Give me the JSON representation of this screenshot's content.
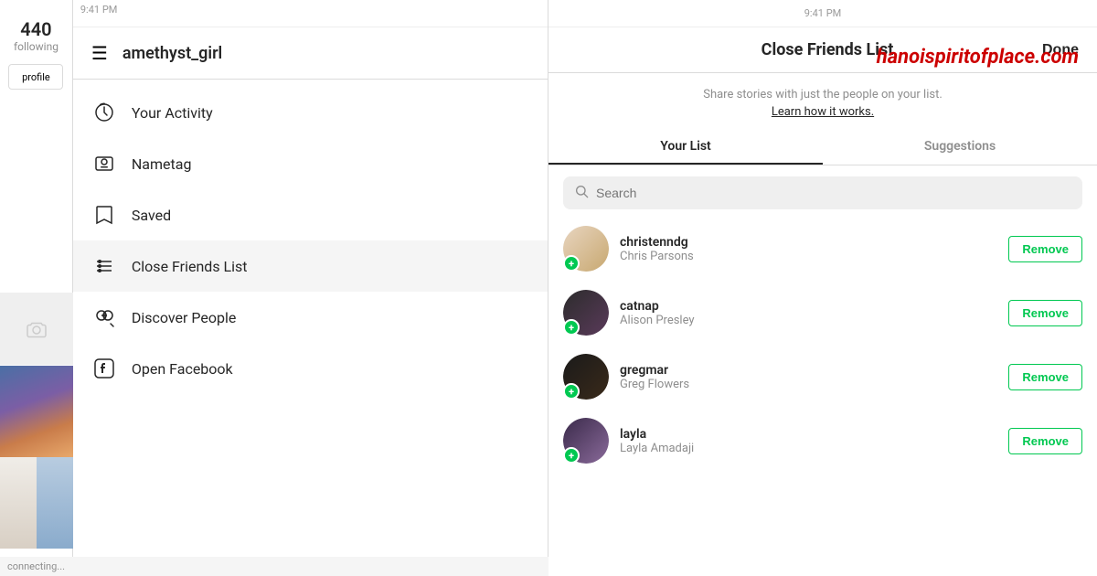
{
  "left": {
    "top_bar": "9:41 PM",
    "following_number": "440",
    "following_label": "following",
    "profile_button": "profile",
    "username": "amethyst_girl",
    "menu_items": [
      {
        "id": "activity",
        "label": "Your Activity",
        "icon": "activity"
      },
      {
        "id": "nametag",
        "label": "Nametag",
        "icon": "nametag"
      },
      {
        "id": "saved",
        "label": "Saved",
        "icon": "saved"
      },
      {
        "id": "close-friends",
        "label": "Close Friends List",
        "icon": "close-friends",
        "active": true
      },
      {
        "id": "discover",
        "label": "Discover People",
        "icon": "discover"
      },
      {
        "id": "facebook",
        "label": "Open Facebook",
        "icon": "facebook"
      }
    ]
  },
  "right": {
    "top_bar": "9:41 PM",
    "title": "Close Friends List",
    "done_label": "Done",
    "watermark": "hanoispiritofplace.com",
    "subtitle": "Share stories with just the people on your list.",
    "learn_link": "Learn how it works.",
    "tabs": [
      {
        "id": "your-list",
        "label": "Your List",
        "active": true
      },
      {
        "id": "suggestions",
        "label": "Suggestions",
        "active": false
      }
    ],
    "search_placeholder": "Search",
    "friends": [
      {
        "username": "christenndg",
        "name": "Chris Parsons",
        "avatar": "1",
        "remove_label": "Remove"
      },
      {
        "username": "catnap",
        "name": "Alison Presley",
        "avatar": "2",
        "remove_label": "Remove"
      },
      {
        "username": "gregmar",
        "name": "Greg Flowers",
        "avatar": "3",
        "remove_label": "Remove"
      },
      {
        "username": "layla",
        "name": "Layla Amadaji",
        "avatar": "4",
        "remove_label": "Remove"
      }
    ],
    "status_text": "connecting..."
  }
}
